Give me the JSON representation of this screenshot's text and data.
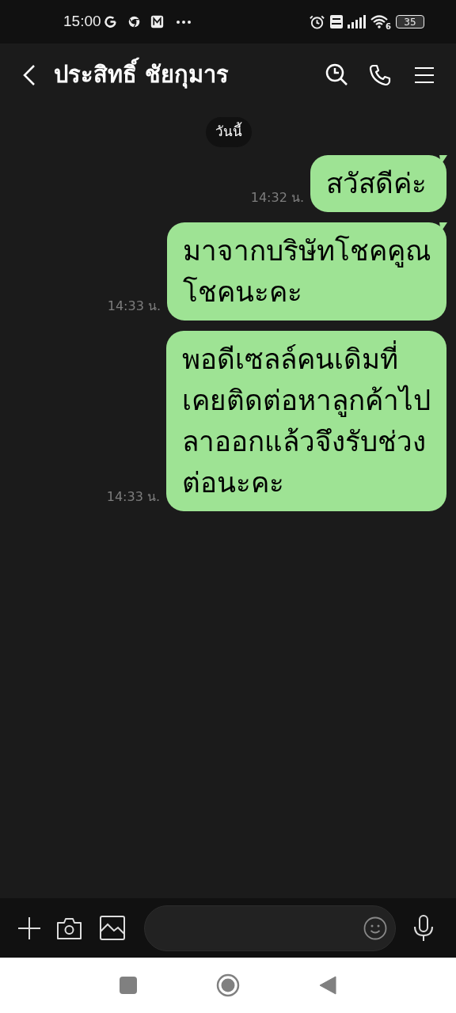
{
  "status_bar": {
    "time": "15:00",
    "wifi_badge": "6",
    "battery": "35"
  },
  "header": {
    "title": "ประสิทธิ์ ชัยกุมาร"
  },
  "date_chip": "วันนี้",
  "messages": [
    {
      "text": "สวัสดีค่ะ",
      "time": "14:32 น.",
      "tail": true
    },
    {
      "text": "มาจากบริษัทโชคคูณ\nโชคนะคะ",
      "time": "14:33 น.",
      "tail": true
    },
    {
      "text": "พอดีเซลล์คนเดิมที่\nเคยติดต่อหาลูกค้าไป\nลาออกแล้วจึงรับช่วง\nต่อนะคะ",
      "time": "14:33 น.",
      "tail": false
    }
  ]
}
